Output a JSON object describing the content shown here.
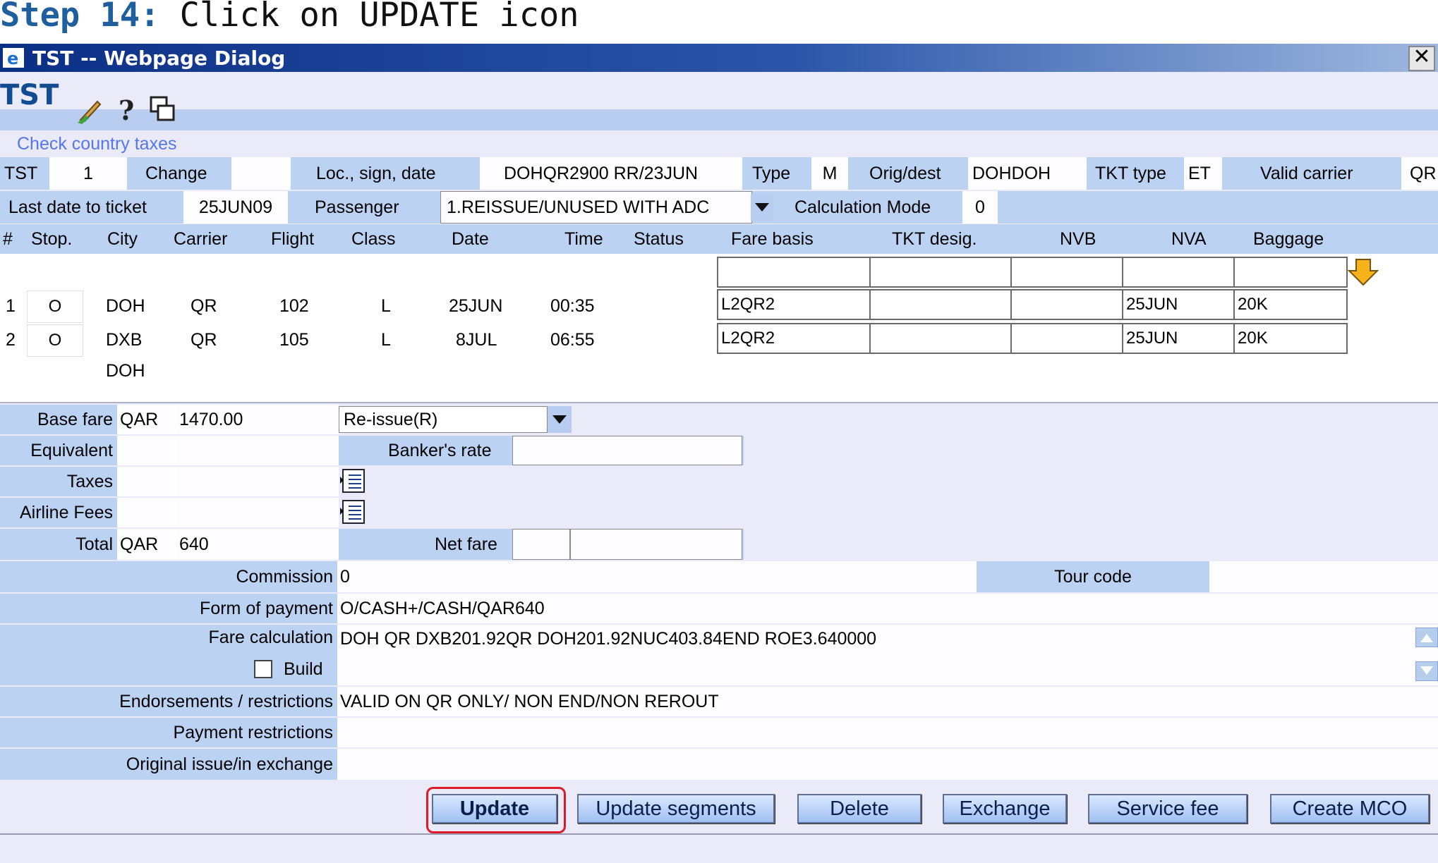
{
  "step": {
    "number": "Step 14:",
    "text": "Click on UPDATE icon"
  },
  "window": {
    "title": "TST -- Webpage Dialog",
    "close": "✕"
  },
  "heading": "TST",
  "toolbar_icons": [
    "broom-icon",
    "help-icon",
    "copy-icon"
  ],
  "link": "Check country taxes",
  "row1": {
    "tst_label": "TST",
    "tst_value": "1",
    "change_label": "Change",
    "change_value": "",
    "loc_label": "Loc., sign, date",
    "loc_value": "DOHQR2900 RR/23JUN",
    "type_label": "Type",
    "type_value": "M",
    "origdest_label": "Orig/dest",
    "origdest_value": "DOHDOH",
    "tkttype_label": "TKT type",
    "tkttype_value": "ET",
    "carrier_label": "Valid carrier",
    "carrier_value": "QR"
  },
  "row2": {
    "lastdate_label": "Last date to ticket",
    "lastdate_value": "25JUN09",
    "passenger_label": "Passenger",
    "passenger_value": "1.REISSUE/UNUSED WITH ADC",
    "calcmode_label": "Calculation Mode",
    "calcmode_value": "0"
  },
  "segment_headers": [
    "#",
    "Stop.",
    "City",
    "Carrier",
    "Flight",
    "Class",
    "Date",
    "Time",
    "Status",
    "Fare basis",
    "TKT desig.",
    "NVB",
    "NVA",
    "Baggage"
  ],
  "segments": [
    {
      "num": "1",
      "stop": "O",
      "city": "DOH",
      "carrier": "QR",
      "flight": "102",
      "class": "L",
      "date": "25JUN",
      "time": "00:35",
      "status": "",
      "fare_basis": "L2QR2",
      "tkt_desig": "",
      "nvb": "",
      "nva": "25JUN",
      "baggage": "20K"
    },
    {
      "num": "2",
      "stop": "O",
      "city": "DXB",
      "carrier": "QR",
      "flight": "105",
      "class": "L",
      "date": "8JUL",
      "time": "06:55",
      "status": "",
      "fare_basis": "L2QR2",
      "tkt_desig": "",
      "nvb": "",
      "nva": "25JUN",
      "baggage": "20K"
    }
  ],
  "final_city": "DOH",
  "fare": {
    "base_label": "Base fare",
    "base_currency": "QAR",
    "base_value": "1470.00",
    "reissue_value": "Re-issue(R)",
    "equivalent_label": "Equivalent",
    "bankers_label": "Banker's rate",
    "taxes_label": "Taxes",
    "airline_fees_label": "Airline Fees",
    "total_label": "Total",
    "total_currency": "QAR",
    "total_value": "640",
    "netfare_label": "Net fare"
  },
  "details": {
    "commission_label": "Commission",
    "commission_value": "0",
    "tourcode_label": "Tour code",
    "fop_label": "Form of payment",
    "fop_value": "O/CASH+/CASH/QAR640",
    "farecalc_label": "Fare calculation",
    "farecalc_value": "DOH QR DXB201.92QR DOH201.92NUC403.84END ROE3.640000",
    "build_label": "Build",
    "endorse_label": "Endorsements / restrictions",
    "endorse_value": "VALID ON QR ONLY/ NON END/NON REROUT",
    "payrestr_label": "Payment restrictions",
    "origissue_label": "Original issue/in exchange"
  },
  "buttons": [
    "Update",
    "Update segments",
    "Delete",
    "Exchange",
    "Service fee",
    "Create MCO"
  ],
  "colors": {
    "header_band": "#bcd2f3",
    "highlight": "#dd1b2b",
    "title": "#134b92"
  }
}
